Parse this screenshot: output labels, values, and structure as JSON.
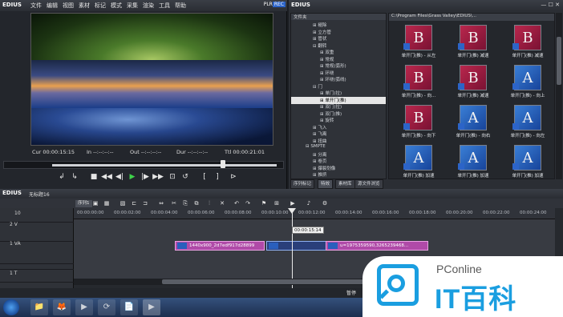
{
  "app": {
    "name": "EDIUS"
  },
  "player": {
    "menu": [
      "文件",
      "编辑",
      "视图",
      "素材",
      "标记",
      "模式",
      "采集",
      "渲染",
      "工具",
      "帮助"
    ],
    "plr_label": "PLR",
    "rec_label": "REC",
    "timecodes": {
      "cur": "Cur 00:00:15:15",
      "in": "In --:--:--:--",
      "out": "Out --:--:--:--",
      "dur": "Dur --:--:--:--",
      "ttl": "Ttl 00:00:21:01"
    },
    "transport_glyphs": [
      "↲",
      "↳",
      "■",
      "◀◀",
      "◀|",
      "▶",
      "|▶",
      "▶▶",
      "⊡",
      "↺",
      "[",
      "]",
      "⊳"
    ]
  },
  "effects": {
    "window_buttons": "— ☐ ✕",
    "tree_header": "文件夹",
    "path": "C:\\Program Files\\Grass Valley\\EDIUS\\...",
    "tree": [
      {
        "label": "⊞ 褪除",
        "indent": 3,
        "selected": false
      },
      {
        "label": "⊞ 立方管",
        "indent": 3,
        "selected": false
      },
      {
        "label": "⊞ 管状",
        "indent": 3,
        "selected": false
      },
      {
        "label": "⊟ 翻转",
        "indent": 3,
        "selected": false
      },
      {
        "label": "⊞ 双重",
        "indent": 4,
        "selected": false
      },
      {
        "label": "⊞ 常规",
        "indent": 4,
        "selected": false
      },
      {
        "label": "⊞ 常规(弧形)",
        "indent": 4,
        "selected": false
      },
      {
        "label": "⊞ 环绕",
        "indent": 4,
        "selected": false
      },
      {
        "label": "⊞ 环绕(弧线)",
        "indent": 4,
        "selected": false
      },
      {
        "label": "⊟ 门",
        "indent": 3,
        "selected": false
      },
      {
        "label": "⊞ 单门(拉)",
        "indent": 4,
        "selected": false
      },
      {
        "label": "⊞ 单开门(推)",
        "indent": 4,
        "selected": true
      },
      {
        "label": "⊞ 双门(拉)",
        "indent": 4,
        "selected": false
      },
      {
        "label": "⊞ 双门(推)",
        "indent": 4,
        "selected": false
      },
      {
        "label": "⊞ 旋转",
        "indent": 4,
        "selected": false
      },
      {
        "label": "⊞ 飞入",
        "indent": 3,
        "selected": false
      },
      {
        "label": "⊞ 飞离",
        "indent": 3,
        "selected": false
      },
      {
        "label": "⊞ 扭曲",
        "indent": 3,
        "selected": false
      },
      {
        "label": "⊟ SMPTE",
        "indent": 2,
        "selected": false
      },
      {
        "label": "⊞ 分离",
        "indent": 3,
        "selected": false
      },
      {
        "label": "⊞ 卷页",
        "indent": 3,
        "selected": false
      },
      {
        "label": "⊞ 爆裂划像",
        "indent": 3,
        "selected": false
      },
      {
        "label": "⊞ 推挤",
        "indent": 3,
        "selected": false
      }
    ],
    "items": [
      {
        "letter": "B",
        "style": "b",
        "label": "单开门(推) - 从左"
      },
      {
        "letter": "B",
        "style": "b",
        "label": "单开门(推) 减速"
      },
      {
        "letter": "B",
        "style": "b",
        "label": "单开门(推) 减速"
      },
      {
        "letter": "B",
        "style": "b",
        "label": "单开门(推) - 向..."
      },
      {
        "letter": "B",
        "style": "b",
        "label": "单开门(推) 减速"
      },
      {
        "letter": "A",
        "style": "a",
        "label": "单开门(推) - 向上"
      },
      {
        "letter": "B",
        "style": "b",
        "label": "单开门(推) - 向下"
      },
      {
        "letter": "A",
        "style": "a",
        "label": "单开门(推) - 向右"
      },
      {
        "letter": "A",
        "style": "a",
        "label": "单开门(推) - 向左"
      },
      {
        "letter": "A",
        "style": "a",
        "label": "单开门(推) 加速"
      },
      {
        "letter": "A",
        "style": "a",
        "label": "单开门(推) 加速"
      },
      {
        "letter": "A",
        "style": "a",
        "label": "单开门(推) 加速"
      }
    ],
    "tabs": [
      "序列标记",
      "特效",
      "素材库",
      "源文件浏览"
    ]
  },
  "timeline": {
    "title": "EDIUS",
    "project": "无标题16",
    "sequence_tab": "序列1",
    "ruler": [
      "00:00:00:00",
      "00:00:02:00",
      "00:00:04:00",
      "00:00:06:00",
      "00:00:08:00",
      "00:00:10:00",
      "00:00:12:00",
      "00:00:14:00",
      "00:00:16:00",
      "00:00:18:00",
      "00:00:20:00",
      "00:00:22:00",
      "00:00:24:00"
    ],
    "playhead": "00:00:15:14",
    "tracks": [
      "10",
      "2 V",
      "1 VA",
      "",
      "1 T"
    ],
    "clips": [
      {
        "name": "1440x900_2d7edf917d28899",
        "lane": 2
      },
      {
        "name": "",
        "lane": 2
      },
      {
        "name": "u=1975359590,3265239468...",
        "lane": 2
      }
    ],
    "status": "暂停"
  },
  "taskbar": {
    "icons": [
      "📁",
      "🦊",
      "▶",
      "⟳",
      "📄",
      "▶"
    ]
  },
  "watermark": {
    "small_text": "PConline",
    "big_text": "IT百科"
  },
  "colors": {
    "accent_blue": "#2c64c8",
    "clip_magenta": "#b04aa8",
    "play_green": "#3ed24a",
    "watermark_blue": "#1a9ee0"
  }
}
